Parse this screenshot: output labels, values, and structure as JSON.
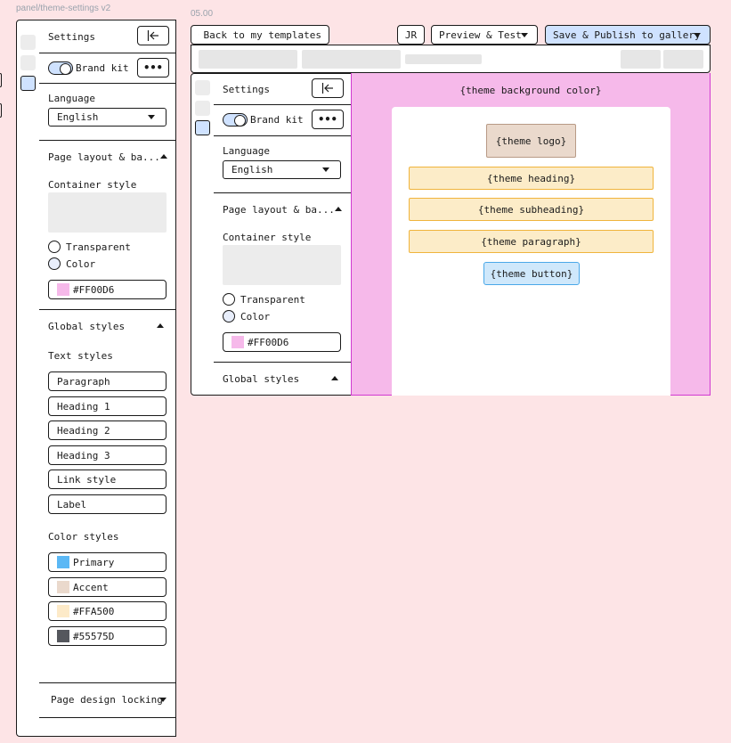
{
  "frame": {
    "label": "panel/theme-settings v2",
    "version": "05.00"
  },
  "panel": {
    "title": "Settings",
    "collapse_icon": "collapse-left-icon",
    "brand_kit_label": "Brand kit",
    "more_label": "•••",
    "language_label": "Language",
    "language_value": "English",
    "page_layout_label": "Page layout & ba...",
    "container_style_label": "Container style",
    "transparent_label": "Transparent",
    "color_label": "Color",
    "color_value": "#FF00D6",
    "color_swatch": "#f6b9ea",
    "global_styles_label": "Global styles",
    "text_styles_label": "Text styles",
    "text_styles": [
      "Paragraph",
      "Heading 1",
      "Heading 2",
      "Heading 3",
      "Link style",
      "Label"
    ],
    "color_styles_label": "Color styles",
    "color_styles": [
      {
        "label": "Primary",
        "swatch": "#5bb8f5"
      },
      {
        "label": "Accent",
        "swatch": "#ead9cc"
      },
      {
        "label": "#FFA500",
        "swatch": "#fdeac8"
      },
      {
        "label": "#55575D",
        "swatch": "#55575d"
      }
    ],
    "page_design_locking_label": "Page design locking"
  },
  "toolbar": {
    "back_label": "Back to my templates",
    "avatar_initials": "JR",
    "preview_label": "Preview & Test",
    "publish_label": "Save & Publish to gallery",
    "publish_color": "#cfe2ff"
  },
  "canvas": {
    "background_color": "#f6b9ea",
    "background_label": "{theme background color}",
    "logo_label": "{theme logo}",
    "heading_label": "{theme heading}",
    "subheading_label": "{theme subheading}",
    "paragraph_label": "{theme paragraph}",
    "button_label": "{theme button}",
    "text_fill": "#fcecc8",
    "text_border": "#f0b43c",
    "logo_fill": "#ead9cc",
    "button_fill": "#cfe8fb",
    "button_border": "#4aa8e8"
  }
}
